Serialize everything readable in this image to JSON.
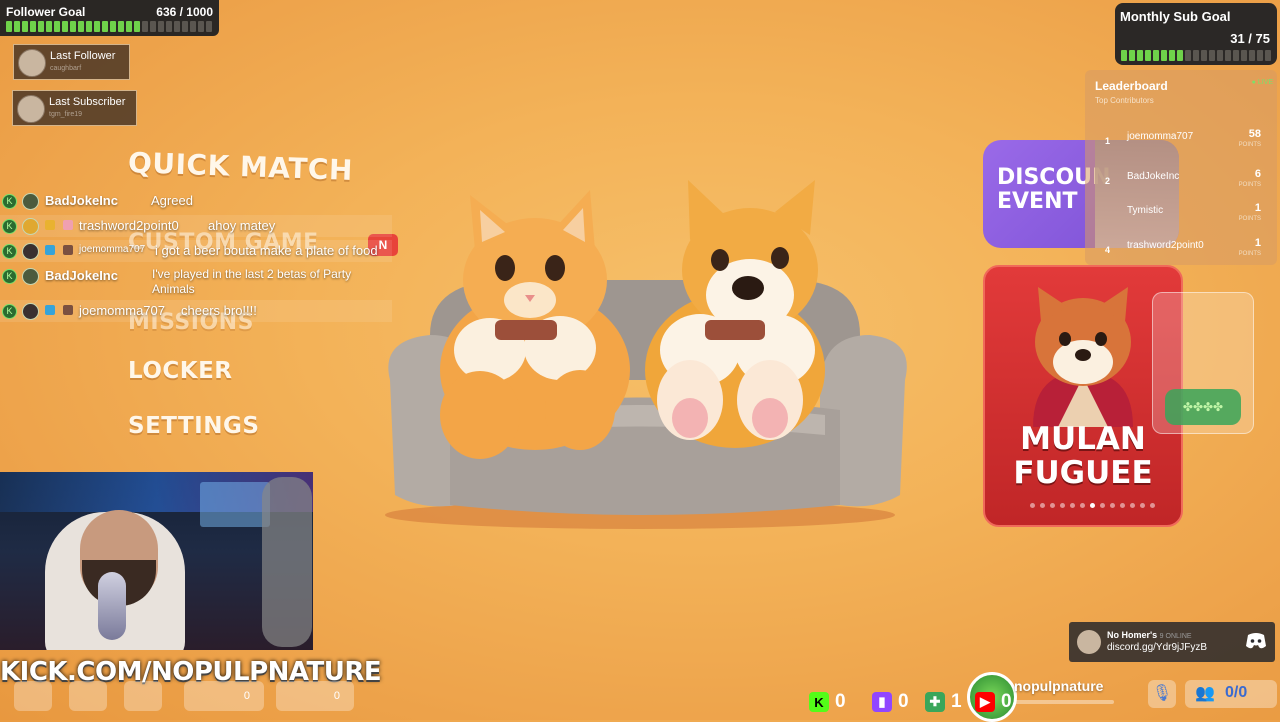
{
  "follower_goal": {
    "title": "Follower Goal",
    "count": "636 / 1000",
    "progress": 0.636
  },
  "last_follower": {
    "label": "Last Follower",
    "name": "caughbarf"
  },
  "last_subscriber": {
    "label": "Last Subscriber",
    "name": "tgm_fire19"
  },
  "menu": {
    "quick_match": "QUICK MATCH",
    "custom_game": "CUSTOM GAME",
    "custom_badge": "N",
    "missions": "MISSIONS",
    "locker": "LOCKER",
    "settings": "SETTINGS"
  },
  "chat": [
    {
      "user": "BadJokeInc",
      "message": "Agreed"
    },
    {
      "user": "trashword2point0",
      "message": "ahoy matey"
    },
    {
      "user": "joemomma707",
      "message": "i got a beer bouta make a plate of food"
    },
    {
      "user": "BadJokeInc",
      "message": "I've played in the last 2 betas of Party Animals"
    },
    {
      "user": "joemomma707",
      "message": "cheers bro!!!!"
    }
  ],
  "sub_goal": {
    "title": "Monthly Sub Goal",
    "count": "31 / 75",
    "progress": 0.413
  },
  "leaderboard": {
    "title": "Leaderboard",
    "subtitle": "Top Contributors",
    "live": "● LIVE",
    "points_label": "POINTS",
    "rows": [
      {
        "rank": "1",
        "name": "joemomma707",
        "points": "58"
      },
      {
        "rank": "2",
        "name": "BadJokeInc",
        "points": "6"
      },
      {
        "rank": "",
        "name": "Tymistic",
        "points": "1"
      },
      {
        "rank": "4",
        "name": "trashword2point0",
        "points": "1"
      }
    ]
  },
  "cards": {
    "discount_line1": "DISCOUN",
    "discount_line2": "EVENT",
    "skin_line1": "MULAN",
    "skin_line2": "FUGUEE"
  },
  "kick_url": "KICK.COM/NOPULPNATURE",
  "discord": {
    "server": "No Homer's",
    "online": "9 ONLINE",
    "url": "discord.gg/Ydr9jJFyzB"
  },
  "bottom_stats": {
    "kick_count": "0",
    "twitch_count": "0",
    "puzzle_count": "1",
    "youtube_count": "0",
    "channel_name": "nopulpnature",
    "viewers": "0/0"
  },
  "bottom_menu": {
    "item4_count": "0",
    "item5_count": "0"
  },
  "colors": {
    "accent_green": "#6fd24a",
    "background": "#f3b258",
    "skin_card": "#d93030",
    "discount_card": "#8a5ee0"
  }
}
